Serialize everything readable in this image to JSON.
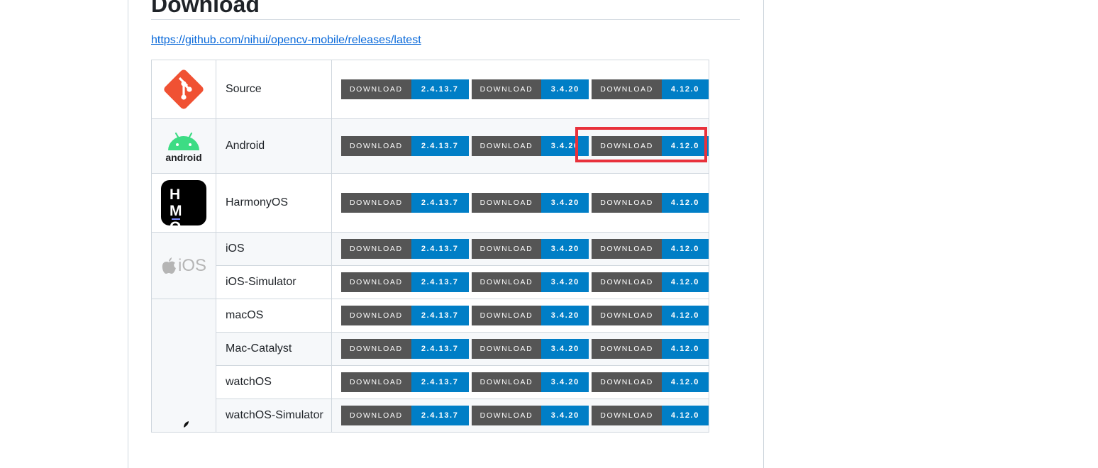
{
  "page": {
    "heading": "Download",
    "release_link": "https://github.com/nihui/opencv-mobile/releases/latest"
  },
  "download_label": "DOWNLOAD",
  "versions": [
    "2.4.13.7",
    "3.4.20",
    "4.12.0"
  ],
  "colors": {
    "badge_left": "#555555",
    "badge_right": "#007ec6",
    "highlight": "#e8313b",
    "link": "#0969da"
  },
  "platforms": [
    {
      "name": "Source",
      "icon": "git-icon"
    },
    {
      "name": "Android",
      "icon": "android-icon",
      "icon_text": "android"
    },
    {
      "name": "HarmonyOS",
      "icon": "harmonyos-icon",
      "icon_text": "HMOS"
    },
    {
      "name": "iOS",
      "icon": "apple-ios-icon",
      "icon_text": "iOS"
    },
    {
      "name": "iOS-Simulator"
    },
    {
      "name": "macOS",
      "icon": "apple-icon"
    },
    {
      "name": "Mac-Catalyst"
    },
    {
      "name": "watchOS"
    },
    {
      "name": "watchOS-Simulator"
    }
  ]
}
